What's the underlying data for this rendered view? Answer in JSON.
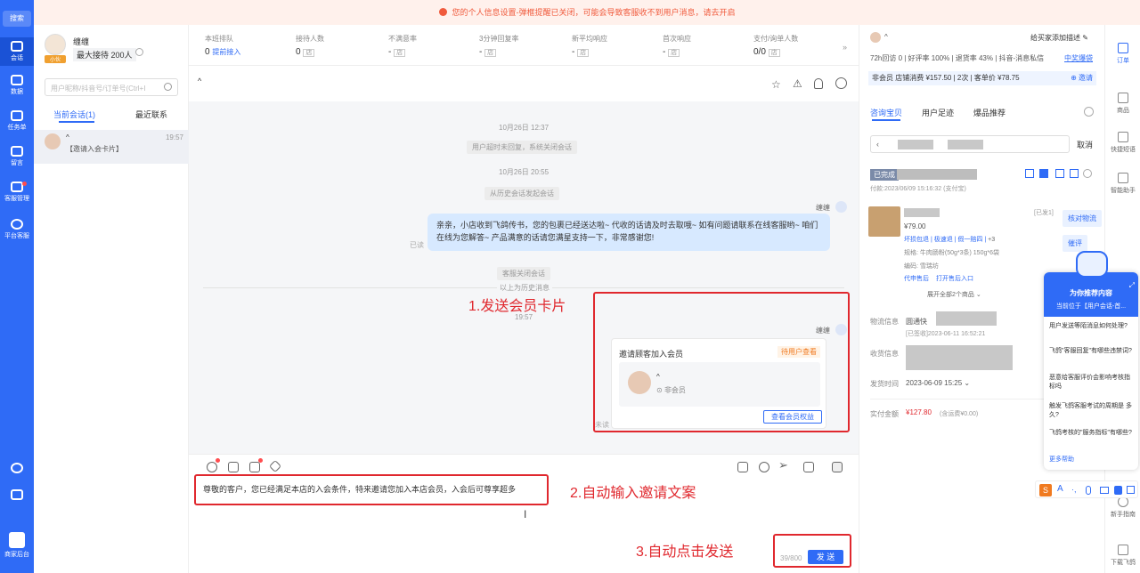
{
  "nav": {
    "search": "搜索",
    "items": [
      {
        "label": "会话",
        "icon": "chat-icon"
      },
      {
        "label": "数据",
        "icon": "chart-icon"
      },
      {
        "label": "任务单",
        "icon": "task-icon"
      },
      {
        "label": "留言",
        "icon": "message-icon"
      },
      {
        "label": "客服管理",
        "icon": "grid-icon"
      },
      {
        "label": "平台客服",
        "icon": "service-icon"
      }
    ],
    "bottom": "商家后台"
  },
  "banner": "您的个人信息设置-弹框提醒已关闭，可能会导致客服收不到用户消息，请去开启",
  "agent": {
    "name": "缠缠",
    "tag": "小伙",
    "max": "最大接待 200人"
  },
  "search": {
    "placeholder": "用户昵称/抖音号/订单号(Ctrl+I"
  },
  "tabs": {
    "current": "当前会话(1)",
    "recent": "最近联系"
  },
  "session": {
    "name": "^",
    "time": "19:57",
    "preview": "【邀请入会卡片】"
  },
  "stats": [
    {
      "label": "本班排队",
      "value": "0",
      "extra": "提前接入"
    },
    {
      "label": "接待人数",
      "value": "0",
      "extra": ""
    },
    {
      "label": "不满意率",
      "value": "-",
      "extra": ""
    },
    {
      "label": "3分钟回复率",
      "value": "-",
      "extra": ""
    },
    {
      "label": "新平均响应",
      "value": "-",
      "extra": ""
    },
    {
      "label": "首次响应",
      "value": "-",
      "extra": ""
    },
    {
      "label": "支付/询单人数",
      "value": "0/0",
      "extra": ""
    }
  ],
  "chat": {
    "title": "^",
    "t1": "10月26日 12:37",
    "s1": "用户超时未回复，系统关闭会话",
    "t2": "10月26日 20:55",
    "s2": "从历史会话发起会话",
    "sender": "缠缠",
    "bubble": "亲亲，小店收到飞鸽传书，您的包裹已经送达啦~ 代收的话请及时去取哦~ 如有问题请联系在线客服哟~ 咱们在线为您解答~ 产品满意的话请您满星支持一下，非常感谢您!",
    "read": "已读",
    "s3": "客服关闭会话",
    "history": "以上为历史消息",
    "t3": "19:57",
    "sender2": "缠缠",
    "unread": "未读",
    "card": {
      "title": "邀请顾客加入会员",
      "status": "待用户查看",
      "user": "^",
      "member": "非会员",
      "button": "查看会员权益"
    }
  },
  "annotations": {
    "a1": "1.发送会员卡片",
    "a2": "2.自动输入邀请文案",
    "a3": "3.自动点击发送"
  },
  "input": {
    "text": "尊敬的客户，您已经满足本店的入会条件，特来邀请您加入本店会员，入会后可尊享超多",
    "count": "39/800",
    "send": "发 送"
  },
  "right": {
    "user": "^",
    "add_desc": "给买家添加描述",
    "stat_line": "72h回访 0 | 好评率 100% | 退货率 43% | 抖音-消息私信",
    "good_rate": "100%",
    "return_rate": "43%",
    "recent_link": "中奖爆袋",
    "member_line": "非会员 店铺消费 ¥157.50 | 2次 | 客单价 ¥78.75",
    "invite": "邀请",
    "tabs": [
      "咨询宝贝",
      "用户足迹",
      "爆品推荐"
    ],
    "cancel": "取消",
    "order_status": "已完成",
    "pay_info": "付款:2023/06/09 15:16:32 (支付宝)",
    "price": "¥79.00",
    "qty": "[已发1]",
    "tags": [
      "坏损包退",
      "极速退",
      "假一赔四",
      "+3"
    ],
    "spec": "规格: 牛肉肠粉(50g*3条) 150g*6袋",
    "code": "编码: 雪瑞坊",
    "after": "代申售后",
    "after2": "打开售后入口",
    "verify": "核对物流",
    "remind": "催评",
    "expand": "展开全部2个商品",
    "logistics_label": "物流信息",
    "logistics": "圆通快",
    "logistics_time": "[已签收]2023-06-11 16:52:21",
    "receive_label": "收货信息",
    "ship_label": "发货时间",
    "ship_time": "2023-06-09 15:25",
    "paid_label": "实付金额",
    "paid": "¥127.80",
    "paid_note": "(含运费¥0.00)"
  },
  "rail": [
    {
      "label": "订单",
      "icon": "order-icon"
    },
    {
      "label": "商品",
      "icon": "product-icon"
    },
    {
      "label": "快捷短语",
      "icon": "send-icon"
    },
    {
      "label": "智能助手",
      "icon": "robot-icon"
    },
    {
      "label": "新手指南",
      "icon": "guide-icon"
    },
    {
      "label": "下载飞鸽",
      "icon": "download-icon"
    }
  ],
  "robot": {
    "title": "为你推荐内容",
    "sub": "当前位于【用户会话-首...",
    "questions": [
      "用户发送等陌消息如何处理?",
      "飞鸽\"客服回复\"有哪些违禁词?",
      "恶意给客服评价会影响考核指标吗",
      "触发飞鸽客服考试的周期是 多久?",
      "飞鸽考核的\"服务指标\"有哪些?"
    ],
    "more": "更多帮助"
  }
}
